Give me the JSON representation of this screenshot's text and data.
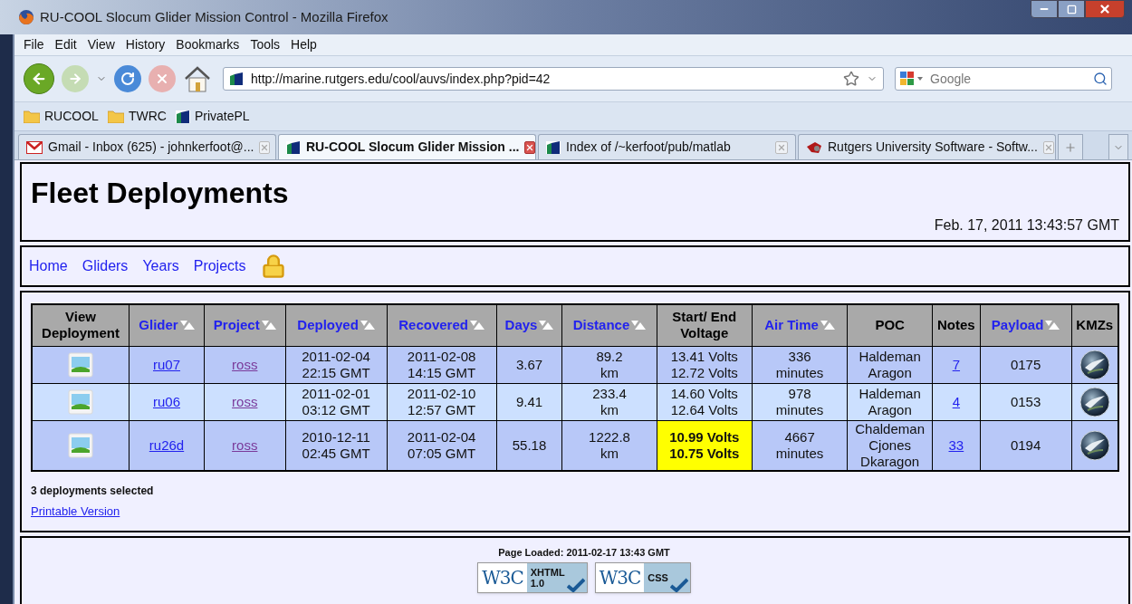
{
  "browser": {
    "title": "RU-COOL Slocum Glider Mission Control - Mozilla Firefox",
    "menu": [
      "File",
      "Edit",
      "View",
      "History",
      "Bookmarks",
      "Tools",
      "Help"
    ],
    "url": "http://marine.rutgers.edu/cool/auvs/index.php?pid=42",
    "search": {
      "placeholder": "Google"
    },
    "bookmarks": [
      {
        "label": "RUCOOL",
        "kind": "folder"
      },
      {
        "label": "TWRC",
        "kind": "folder"
      },
      {
        "label": "PrivatePL",
        "kind": "site"
      }
    ],
    "tabs": [
      {
        "label": "Gmail - Inbox (625) - johnkerfoot@...",
        "kind": "mail",
        "selected": false
      },
      {
        "label": "RU-COOL Slocum Glider Mission ...",
        "kind": "site",
        "selected": true
      },
      {
        "label": "Index of /~kerfoot/pub/matlab",
        "kind": "site",
        "selected": false
      },
      {
        "label": "Rutgers University Software - Softw...",
        "kind": "shop",
        "selected": false
      }
    ]
  },
  "page": {
    "title": "Fleet Deployments",
    "timestamp": "Feb. 17, 2011 13:43:57 GMT",
    "nav": [
      "Home",
      "Gliders",
      "Years",
      "Projects"
    ],
    "table": {
      "columns": [
        {
          "label": "View Deployment",
          "sortable": false
        },
        {
          "label": "Glider",
          "sortable": true
        },
        {
          "label": "Project",
          "sortable": true
        },
        {
          "label": "Deployed",
          "sortable": true
        },
        {
          "label": "Recovered",
          "sortable": true
        },
        {
          "label": "Days",
          "sortable": true
        },
        {
          "label": "Distance",
          "sortable": true
        },
        {
          "label": "Start/ End Voltage",
          "sortable": false
        },
        {
          "label": "Air Time",
          "sortable": true
        },
        {
          "label": "POC",
          "sortable": false
        },
        {
          "label": "Notes",
          "sortable": false
        },
        {
          "label": "Payload",
          "sortable": true
        },
        {
          "label": "KMZs",
          "sortable": false
        }
      ],
      "rows": [
        {
          "glider": "ru07",
          "project": "ross",
          "deployed": [
            "2011-02-04",
            "22:15 GMT"
          ],
          "recovered": [
            "2011-02-08",
            "14:15 GMT"
          ],
          "days": "3.67",
          "distance": [
            "89.2",
            "km"
          ],
          "voltage": [
            "13.41 Volts",
            "12.72 Volts"
          ],
          "low_voltage": false,
          "air_time": [
            "336",
            "minutes"
          ],
          "poc": [
            "Haldeman",
            "Aragon"
          ],
          "notes": "7",
          "payload": "0175"
        },
        {
          "glider": "ru06",
          "project": "ross",
          "deployed": [
            "2011-02-01",
            "03:12 GMT"
          ],
          "recovered": [
            "2011-02-10",
            "12:57 GMT"
          ],
          "days": "9.41",
          "distance": [
            "233.4",
            "km"
          ],
          "voltage": [
            "14.60 Volts",
            "12.64 Volts"
          ],
          "low_voltage": false,
          "air_time": [
            "978",
            "minutes"
          ],
          "poc": [
            "Haldeman",
            "Aragon"
          ],
          "notes": "4",
          "payload": "0153"
        },
        {
          "glider": "ru26d",
          "project": "ross",
          "deployed": [
            "2010-12-11",
            "02:45 GMT"
          ],
          "recovered": [
            "2011-02-04",
            "07:05 GMT"
          ],
          "days": "55.18",
          "distance": [
            "1222.8",
            "km"
          ],
          "voltage": [
            "10.99 Volts",
            "10.75 Volts"
          ],
          "low_voltage": true,
          "air_time": [
            "4667",
            "minutes"
          ],
          "poc": [
            "Chaldeman",
            "Cjones",
            "Dkaragon"
          ],
          "notes": "33",
          "payload": "0194"
        }
      ]
    },
    "summary": "3 deployments selected",
    "printable": "Printable Version",
    "footer": {
      "loaded": "Page Loaded: 2011-02-17 13:43 GMT",
      "badges": [
        {
          "mark": "W3C",
          "lines": [
            "XHTML",
            "1.0"
          ]
        },
        {
          "mark": "W3C",
          "lines": [
            "CSS"
          ]
        }
      ]
    }
  }
}
